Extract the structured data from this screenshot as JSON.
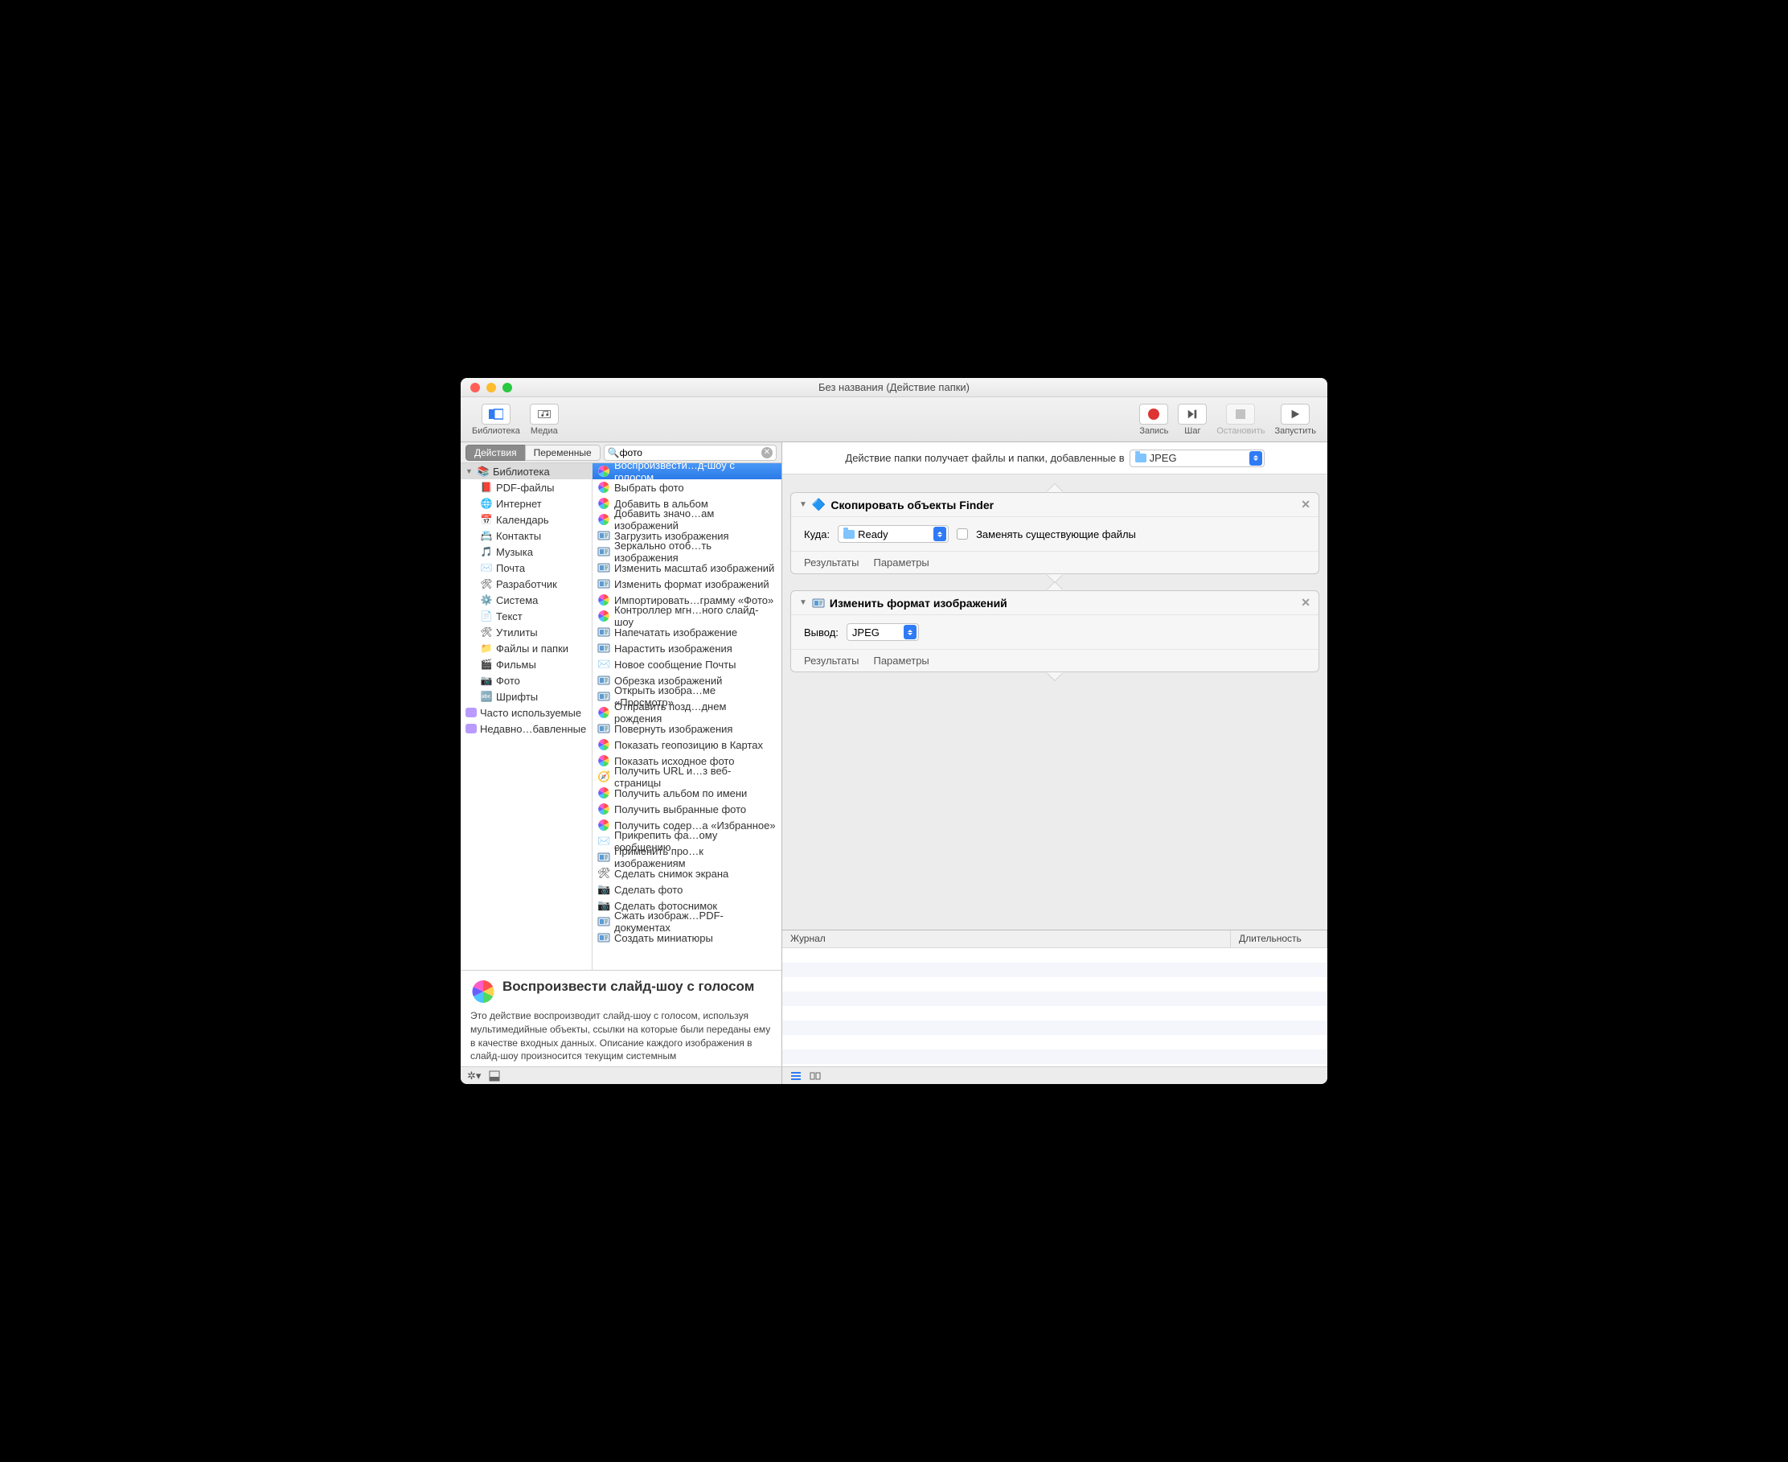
{
  "window": {
    "title": "Без названия (Действие папки)"
  },
  "toolbar": {
    "library": "Библиотека",
    "media": "Медиа",
    "record": "Запись",
    "step": "Шаг",
    "stop": "Остановить",
    "run": "Запустить"
  },
  "tabs": {
    "actions": "Действия",
    "variables": "Переменные"
  },
  "search": {
    "value": "фото"
  },
  "library": {
    "root": "Библиотека",
    "items": [
      "PDF-файлы",
      "Интернет",
      "Календарь",
      "Контакты",
      "Музыка",
      "Почта",
      "Разработчик",
      "Система",
      "Текст",
      "Утилиты",
      "Файлы и папки",
      "Фильмы",
      "Фото",
      "Шрифты"
    ],
    "smart1": "Часто используемые",
    "smart2": "Недавно…бавленные"
  },
  "actions": [
    "Воспроизвести…д-шоу с голосом",
    "Выбрать фото",
    "Добавить в альбом",
    "Добавить значо…ам изображений",
    "Загрузить изображения",
    "Зеркально отоб…ть изображения",
    "Изменить масштаб изображений",
    "Изменить формат изображений",
    "Импортировать…грамму «Фото»",
    "Контроллер мгн…ного слайд-шоу",
    "Напечатать изображение",
    "Нарастить изображения",
    "Новое сообщение Почты",
    "Обрезка изображений",
    "Открыть изобра…ме «Просмотр»",
    "Отправить позд…днем рождения",
    "Повернуть изображения",
    "Показать геопозицию в Картах",
    "Показать исходное фото",
    "Получить URL и…з веб-страницы",
    "Получить альбом по имени",
    "Получить выбранные фото",
    "Получить содер…а «Избранное»",
    "Прикрепить фа…ому сообщению",
    "Применить про…к изображениям",
    "Сделать снимок экрана",
    "Сделать фото",
    "Сделать фотоснимок",
    "Сжать изображ…PDF-документах",
    "Создать миниатюры"
  ],
  "action_icons": [
    "color",
    "color",
    "color",
    "color",
    "preview",
    "preview",
    "preview",
    "preview",
    "color",
    "color",
    "preview",
    "preview",
    "mail",
    "preview",
    "preview",
    "color",
    "preview",
    "color",
    "color",
    "safari",
    "color",
    "color",
    "color",
    "mail",
    "preview",
    "tools",
    "camera",
    "camera",
    "preview",
    "preview"
  ],
  "desc": {
    "title": "Воспроизвести слайд-шоу с голосом",
    "body": "Это действие воспроизводит слайд-шоу с голосом, используя мультимедийные объекты, ссылки на которые были переданы ему в качестве входных данных. Описание каждого изображения в слайд-шоу произносится текущим системным"
  },
  "input_label": "Действие папки получает файлы и папки, добавленные в",
  "input_folder": "JPEG",
  "card1": {
    "title": "Скопировать объекты Finder",
    "where_label": "Куда:",
    "where_value": "Ready",
    "replace": "Заменять существующие файлы",
    "results": "Результаты",
    "params": "Параметры"
  },
  "card2": {
    "title": "Изменить формат изображений",
    "out_label": "Вывод:",
    "out_value": "JPEG",
    "results": "Результаты",
    "params": "Параметры"
  },
  "log": {
    "col1": "Журнал",
    "col2": "Длительность"
  }
}
